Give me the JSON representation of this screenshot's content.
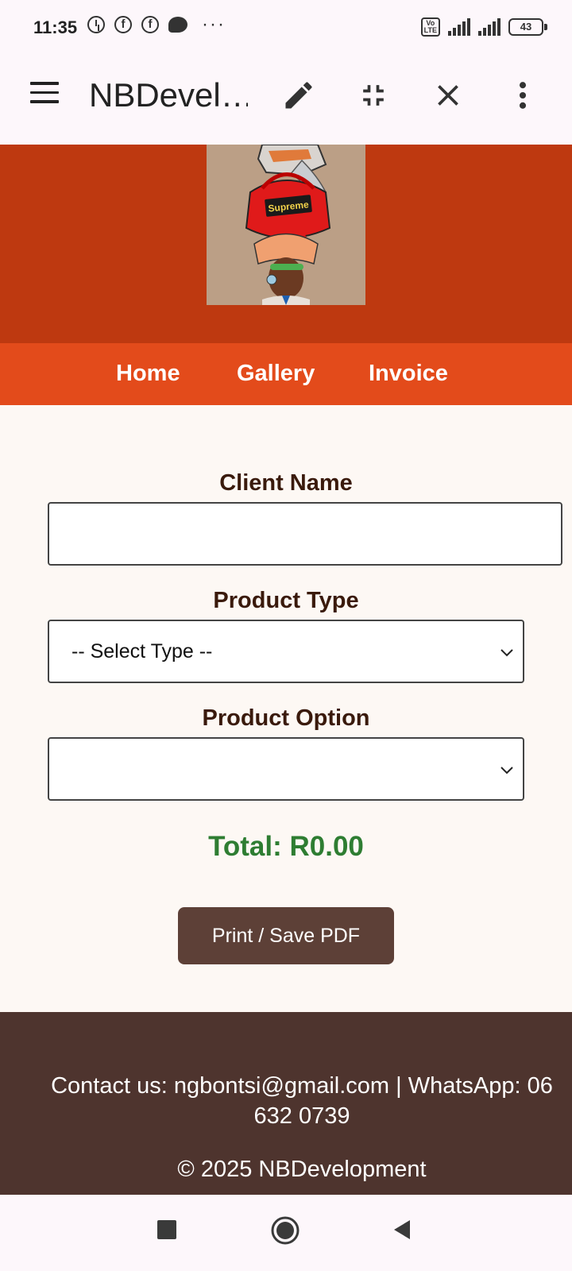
{
  "status_bar": {
    "time": "11:35",
    "notification_icons": [
      "alarm-icon",
      "facebook-icon",
      "facebook-icon",
      "chat-icon"
    ],
    "more": "···",
    "network": "4G",
    "volte": "Vo LTE",
    "battery": "43"
  },
  "app_bar": {
    "title": "NBDevel…",
    "icons": [
      "menu-icon",
      "edit-icon",
      "collapse-icon",
      "close-icon",
      "more-vert-icon"
    ]
  },
  "logo": {
    "brand_text": "Supreme"
  },
  "nav": {
    "items": [
      {
        "label": "Home"
      },
      {
        "label": "Gallery"
      },
      {
        "label": "Invoice"
      }
    ]
  },
  "form": {
    "client_name_label": "Client Name",
    "client_name_value": "",
    "product_type_label": "Product Type",
    "product_type_value": "-- Select Type --",
    "product_option_label": "Product Option",
    "product_option_value": "",
    "total": "Total: R0.00",
    "print_button": "Print / Save PDF"
  },
  "footer": {
    "contact_line1": "Contact us: ngbontsi@gmail.com | WhatsApp: 06",
    "contact_line2": "632 0739",
    "copyright": "© 2025 NBDevelopment"
  },
  "colors": {
    "banner": "#be3910",
    "nav": "#e34b1b",
    "total": "#2e7d32",
    "button": "#5d4037",
    "footer": "#4e342e"
  }
}
